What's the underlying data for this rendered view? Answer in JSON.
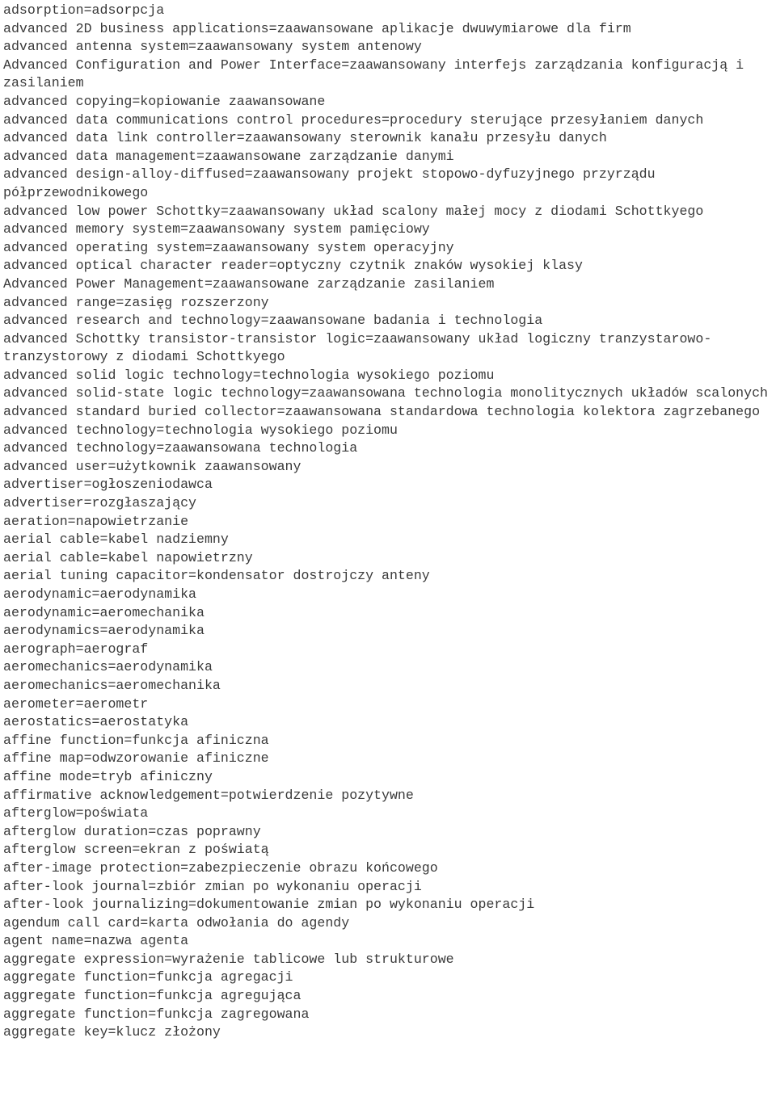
{
  "document": {
    "type": "plain-text-glossary",
    "language_pair": "English-Polish",
    "wrap_columns": 84,
    "text_color": "#3a3a3a",
    "background_color": "#ffffff",
    "entries": [
      "adsorption=adsorpcja",
      "advanced 2D business applications=zaawansowane aplikacje dwuwymiarowe dla firm",
      "advanced antenna system=zaawansowany system antenowy",
      "Advanced Configuration and Power Interface=zaawansowany interfejs zarządzania konfiguracją i zasilaniem",
      "advanced copying=kopiowanie zaawansowane",
      "advanced data communications control procedures=procedury sterujące przesyłaniem danych",
      "advanced data link controller=zaawansowany sterownik kanału przesyłu danych",
      "advanced data management=zaawansowane zarządzanie danymi",
      "advanced design-alloy-diffused=zaawansowany projekt stopowo-dyfuzyjnego przyrządu półprzewodnikowego",
      "advanced low power Schottky=zaawansowany układ scalony małej mocy z diodami Schottkyego",
      "advanced memory system=zaawansowany system pamięciowy",
      "advanced operating system=zaawansowany system operacyjny",
      "advanced optical character reader=optyczny czytnik znaków wysokiej klasy",
      "Advanced Power Management=zaawansowane zarządzanie zasilaniem",
      "advanced range=zasięg rozszerzony",
      "advanced research and technology=zaawansowane badania i technologia",
      "advanced Schottky transistor-transistor logic=zaawansowany układ logiczny tranzystarowo-tranzystorowy z diodami Schottkyego",
      "advanced solid logic technology=technologia wysokiego poziomu",
      "advanced solid-state logic technology=zaawansowana technologia monolitycznych układów scalonych",
      "advanced standard buried collector=zaawansowana standardowa technologia kolektora zagrzebanego",
      "advanced technology=technologia wysokiego poziomu",
      "advanced technology=zaawansowana technologia",
      "advanced user=użytkownik zaawansowany",
      "advertiser=ogłoszeniodawca",
      "advertiser=rozgłaszający",
      "aeration=napowietrzanie",
      "aerial cable=kabel nadziemny",
      "aerial cable=kabel napowietrzny",
      "aerial tuning capacitor=kondensator dostrojczy anteny",
      "aerodynamic=aerodynamika",
      "aerodynamic=aeromechanika",
      "aerodynamics=aerodynamika",
      "aerograph=aerograf",
      "aeromechanics=aerodynamika",
      "aeromechanics=aeromechanika",
      "aerometer=aerometr",
      "aerostatics=aerostatyka",
      "affine function=funkcja afiniczna",
      "affine map=odwzorowanie afiniczne",
      "affine mode=tryb afiniczny",
      "affirmative acknowledgement=potwierdzenie pozytywne",
      "afterglow=poświata",
      "afterglow duration=czas poprawny",
      "afterglow screen=ekran z poświatą",
      "after-image protection=zabezpieczenie obrazu końcowego",
      "after-look journal=zbiór zmian po wykonaniu operacji",
      "after-look journalizing=dokumentowanie zmian po wykonaniu operacji",
      "agendum call card=karta odwołania do agendy",
      "agent name=nazwa agenta",
      "aggregate expression=wyrażenie tablicowe lub strukturowe",
      "aggregate function=funkcja agregacji",
      "aggregate function=funkcja agregująca",
      "aggregate function=funkcja zagregowana",
      "aggregate key=klucz złożony"
    ]
  }
}
